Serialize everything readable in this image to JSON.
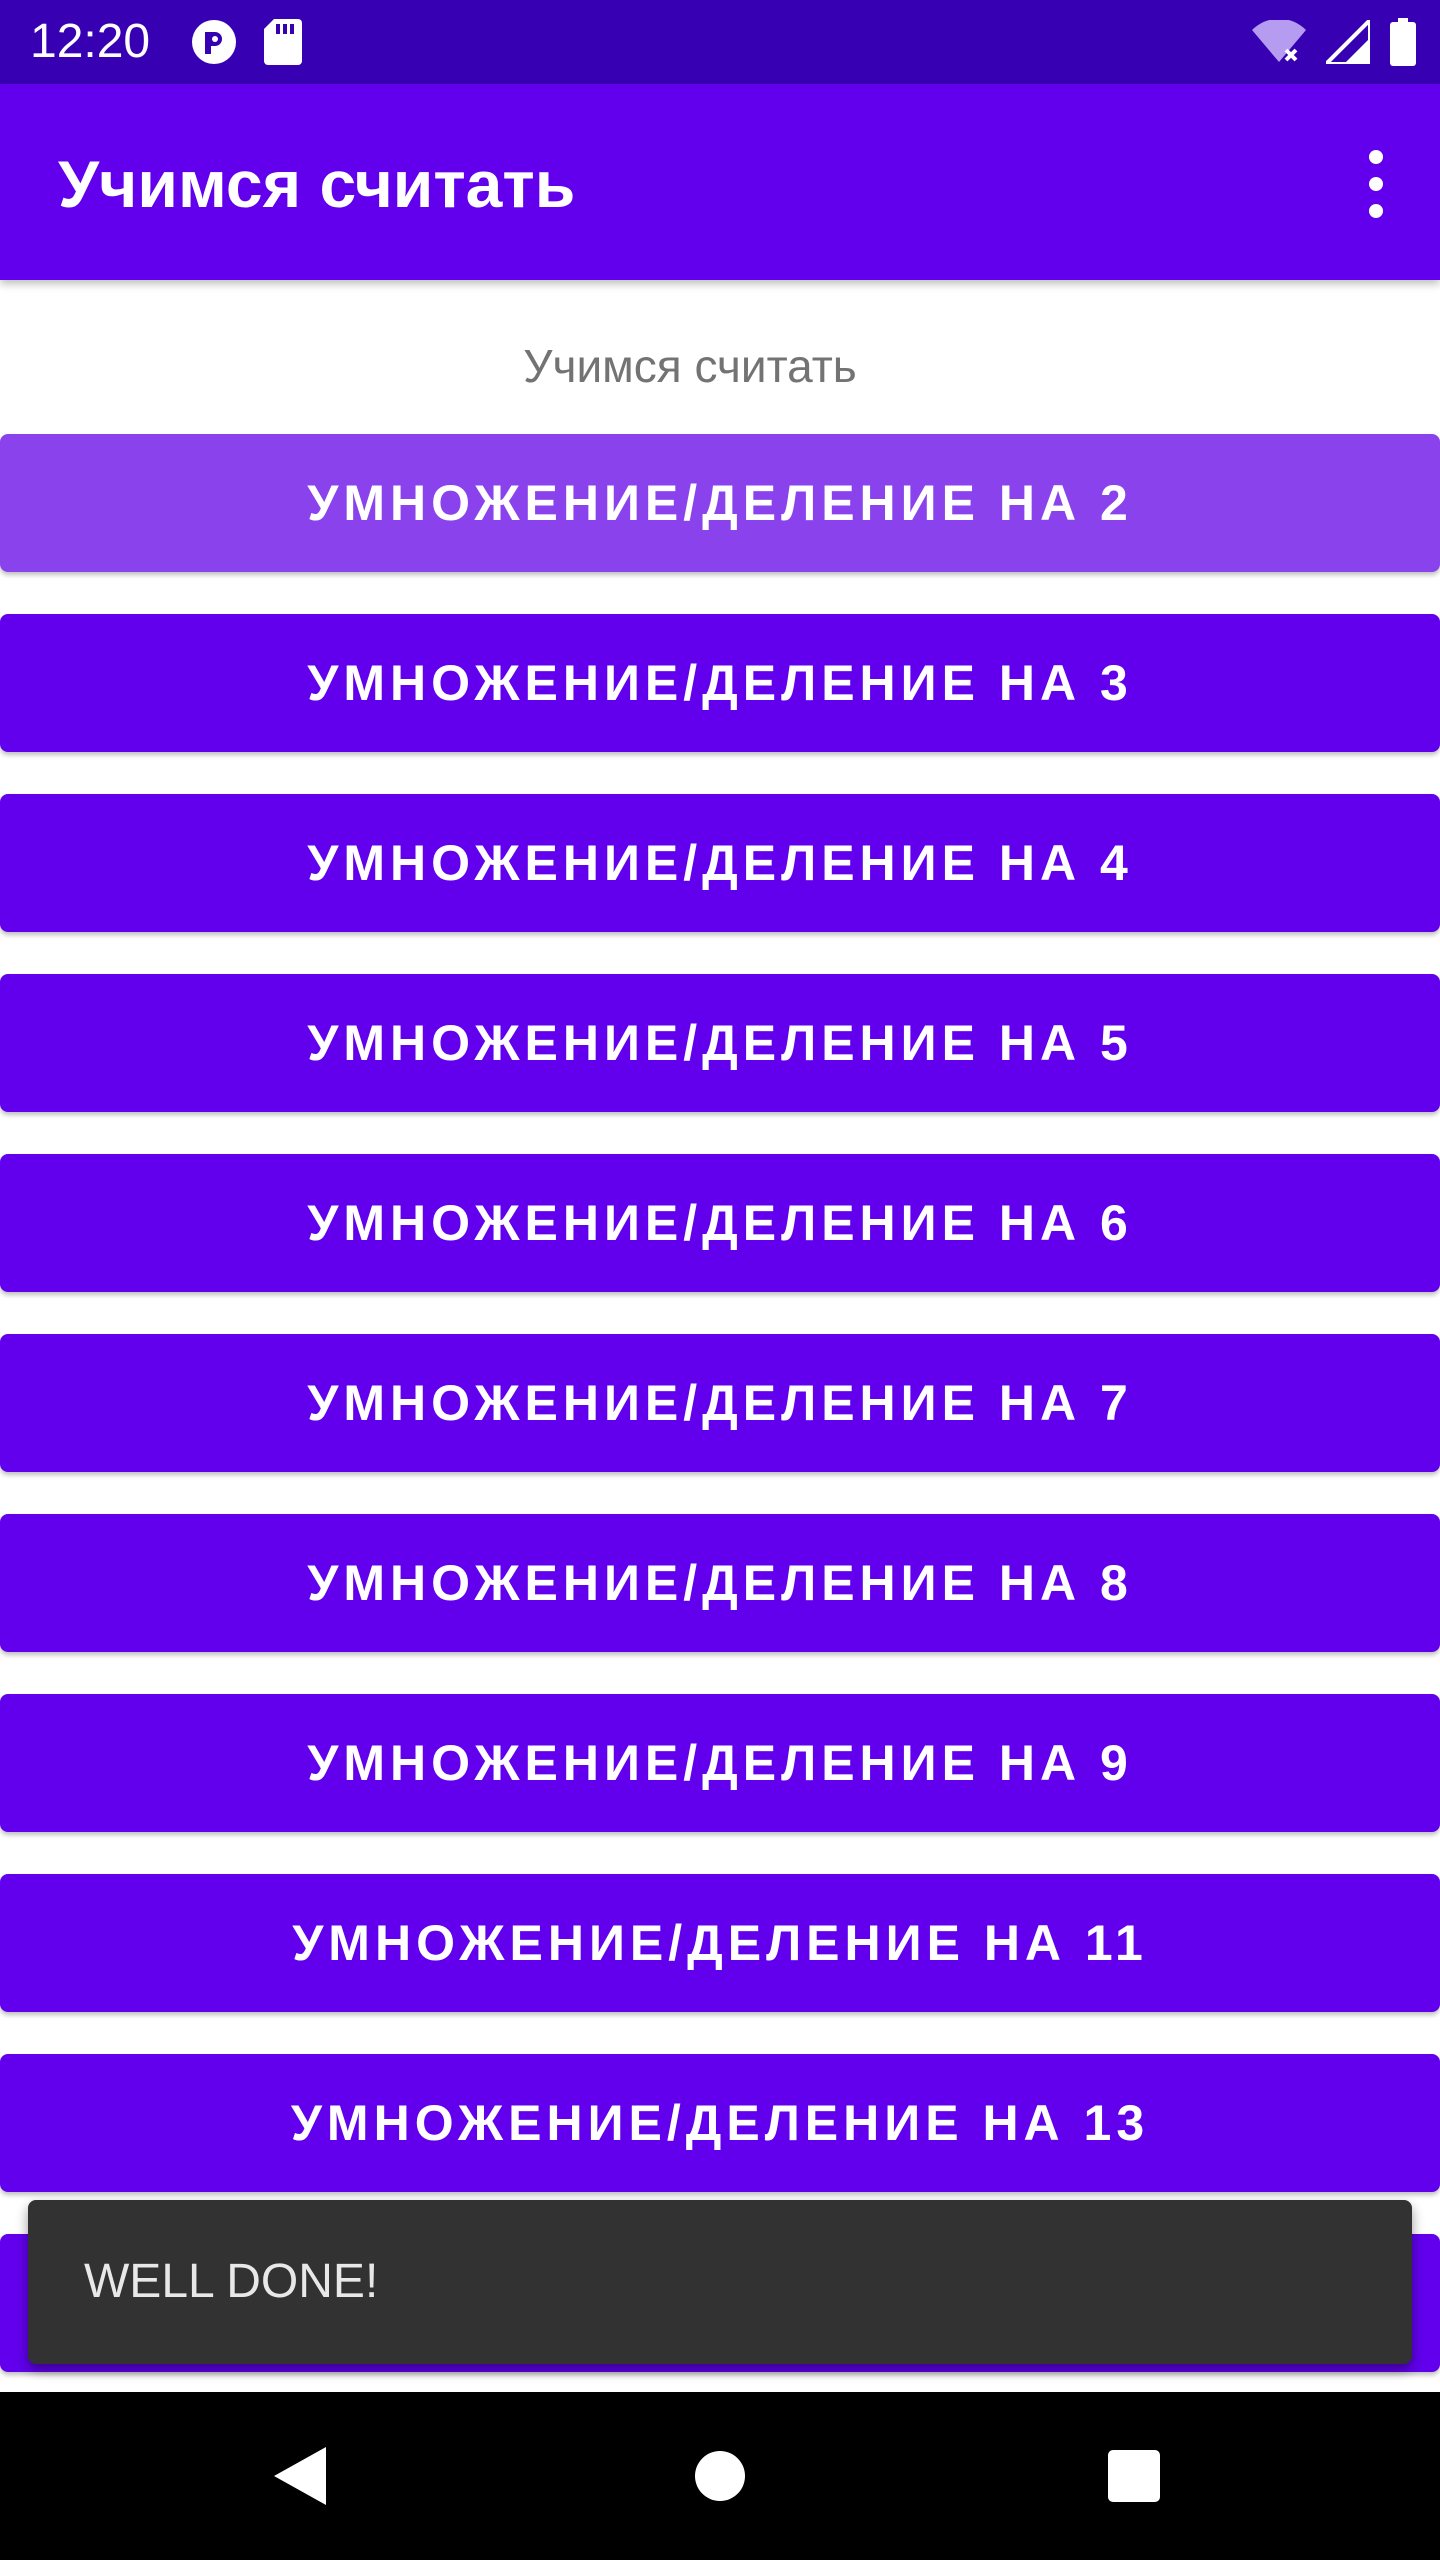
{
  "status_bar": {
    "time": "12:20",
    "icons": [
      "sync-icon",
      "sd-card-icon",
      "wifi-icon",
      "signal-icon",
      "battery-icon"
    ],
    "background": "#3700b3"
  },
  "app_bar": {
    "title": "Учимся считать",
    "menu_icon": "more-vert-icon",
    "background": "#6200ee"
  },
  "main": {
    "subtitle": "Учимся считать",
    "buttons": [
      {
        "label": "УМНОЖЕНИЕ/ДЕЛЕНИЕ НА 2",
        "state": "pressed"
      },
      {
        "label": "УМНОЖЕНИЕ/ДЕЛЕНИЕ НА 3"
      },
      {
        "label": "УМНОЖЕНИЕ/ДЕЛЕНИЕ НА 4"
      },
      {
        "label": "УМНОЖЕНИЕ/ДЕЛЕНИЕ НА 5"
      },
      {
        "label": "УМНОЖЕНИЕ/ДЕЛЕНИЕ НА 6"
      },
      {
        "label": "УМНОЖЕНИЕ/ДЕЛЕНИЕ НА 7"
      },
      {
        "label": "УМНОЖЕНИЕ/ДЕЛЕНИЕ НА 8"
      },
      {
        "label": "УМНОЖЕНИЕ/ДЕЛЕНИЕ НА 9"
      },
      {
        "label": "УМНОЖЕНИЕ/ДЕЛЕНИЕ НА 11"
      },
      {
        "label": "УМНОЖЕНИЕ/ДЕЛЕНИЕ НА 13"
      }
    ],
    "button_color": "#6200ee",
    "pressed_color": "#8a43ec"
  },
  "snackbar": {
    "message": "WELL DONE!"
  },
  "nav_bar": {
    "icons": [
      "back-icon",
      "home-icon",
      "recents-icon"
    ]
  }
}
